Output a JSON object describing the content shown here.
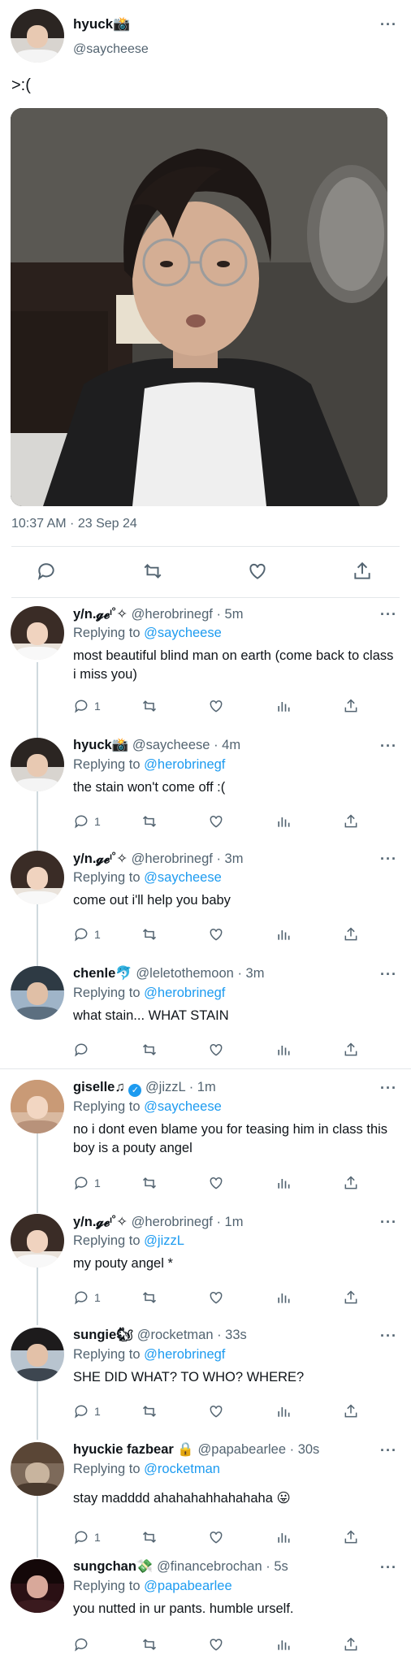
{
  "main_tweet": {
    "name": "hyuck📸",
    "handle": "@saycheese",
    "text": ">:(",
    "timestamp": "10:37 AM · 23 Sep 24",
    "more_icon": "more-dots-icon",
    "actions": [
      "reply-icon",
      "retweet-icon",
      "like-icon",
      "share-icon"
    ]
  },
  "replies": [
    {
      "name": "y/n.𝓰𝓮ᶦ˚✧",
      "handle": "@herobrinegf",
      "time": "· 5m",
      "replying_prefix": "Replying to",
      "replying_to": "@saycheese",
      "text": "most beautiful blind man on earth (come back to class i miss you)",
      "reply_count": "1"
    },
    {
      "name": "hyuck📸",
      "handle": "@saycheese",
      "time": "· 4m",
      "replying_prefix": "Replying to",
      "replying_to": "@herobrinegf",
      "text": "the stain won't come off :(",
      "reply_count": "1"
    },
    {
      "name": "y/n.𝓰𝓮ᶦ˚✧",
      "handle": "@herobrinegf",
      "time": "· 3m",
      "replying_prefix": "Replying to",
      "replying_to": "@saycheese",
      "text": "come out i'll help you baby",
      "reply_count": "1"
    },
    {
      "name": "chenle🐬",
      "handle": "@leletothemoon",
      "time": "· 3m",
      "replying_prefix": "Replying to",
      "replying_to": "@herobrinegf",
      "text": "what stain... WHAT STAIN",
      "reply_count": ""
    },
    {
      "name": "giselle♫",
      "handle": "@jizzL",
      "time": "· 1m",
      "verified": true,
      "replying_prefix": "Replying to",
      "replying_to": "@saycheese",
      "text": "no i dont even blame you for teasing him in class this boy is a pouty angel",
      "reply_count": "1"
    },
    {
      "name": "y/n.𝓰𝓮ᶦ˚✧",
      "handle": "@herobrinegf",
      "time": "· 1m",
      "replying_prefix": "Replying to",
      "replying_to": "@jizzL",
      "text": "my pouty angel *",
      "reply_count": "1"
    },
    {
      "name": "sungie🐿",
      "handle": "@rocketman",
      "time": "· 33s",
      "replying_prefix": "Replying to",
      "replying_to": "@herobrinegf",
      "text": "SHE DID WHAT? TO WHO? WHERE?",
      "reply_count": "1"
    },
    {
      "name": "hyuckie fazbear 🔒",
      "handle": "@papabearlee",
      "time": "· 30s",
      "replying_prefix": "Replying to",
      "replying_to": "@rocketman",
      "text": "stay madddd ahahahahhahahaha 😛",
      "reply_count": "1"
    },
    {
      "name": "sungchan💸",
      "handle": "@financebrochan",
      "time": "· 5s",
      "replying_prefix": "Replying to",
      "replying_to": "@papabearlee",
      "text": "you nutted in ur pants. humble urself.",
      "reply_count": ""
    }
  ],
  "colors": {
    "link": "#1d9bf0",
    "secondary_text": "#536471",
    "divider": "#e3e7ea",
    "thread_line": "#cfd9de"
  }
}
